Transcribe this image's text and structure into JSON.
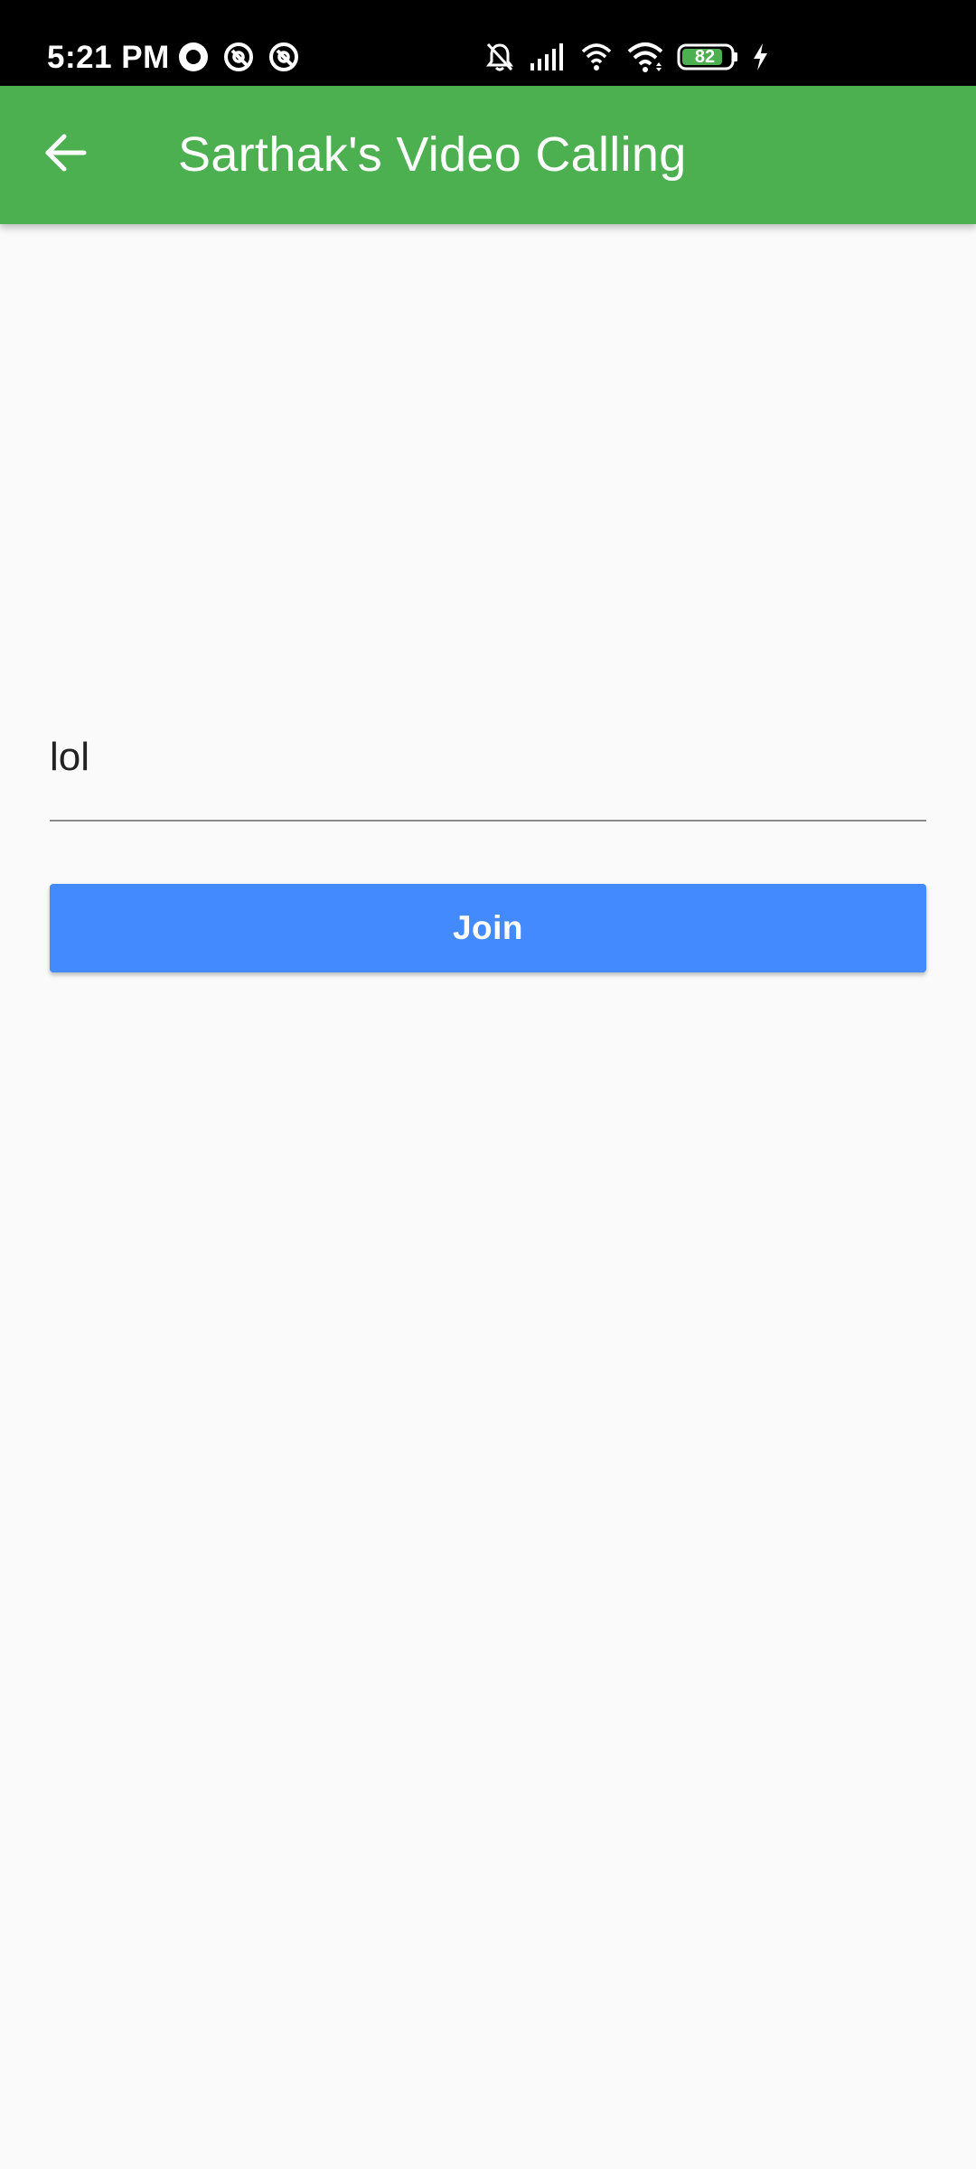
{
  "status_bar": {
    "time": "5:21 PM",
    "battery_level": "82",
    "left_icons": [
      "record-icon",
      "at-sign-icon",
      "at-sign-icon"
    ],
    "right_icons": [
      "bell-off-icon",
      "signal-bars-icon",
      "hotspot-icon",
      "wifi-icon",
      "battery-icon",
      "charging-bolt-icon"
    ]
  },
  "app_bar": {
    "title": "Sarthak's Video Calling",
    "back_icon": "arrow-left-icon",
    "color": "#4caf50"
  },
  "form": {
    "channel_input_value": "lol",
    "join_label": "Join",
    "join_color": "#448aff"
  },
  "colors": {
    "background": "#fafafa",
    "status_bar": "#000000",
    "battery_fill": "#4caf50"
  }
}
